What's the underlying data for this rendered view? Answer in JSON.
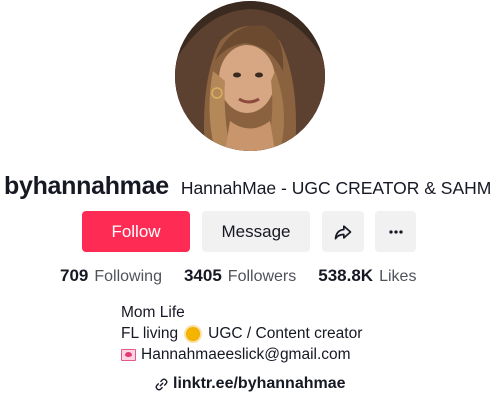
{
  "profile": {
    "username": "byhannahmae",
    "display_name": "HannahMae - UGC CREATOR & SAHM"
  },
  "actions": {
    "follow_label": "Follow",
    "message_label": "Message",
    "share_icon": "share-arrow-icon",
    "more_icon": "more-dots-icon"
  },
  "stats": [
    {
      "value": "709",
      "label": "Following"
    },
    {
      "value": "3405",
      "label": "Followers"
    },
    {
      "value": "538.8K",
      "label": "Likes"
    }
  ],
  "bio": {
    "line1": "Mom Life",
    "line2_prefix": "FL living",
    "line2_suffix": "UGC / Content creator",
    "line3_email": "Hannahmaeeslick@gmail.com"
  },
  "link": {
    "text": "linktr.ee/byhannahmae"
  },
  "colors": {
    "accent": "#fe2c55",
    "button_secondary": "#f1f1f2",
    "text_primary": "#161823",
    "text_secondary": "#50525a"
  }
}
